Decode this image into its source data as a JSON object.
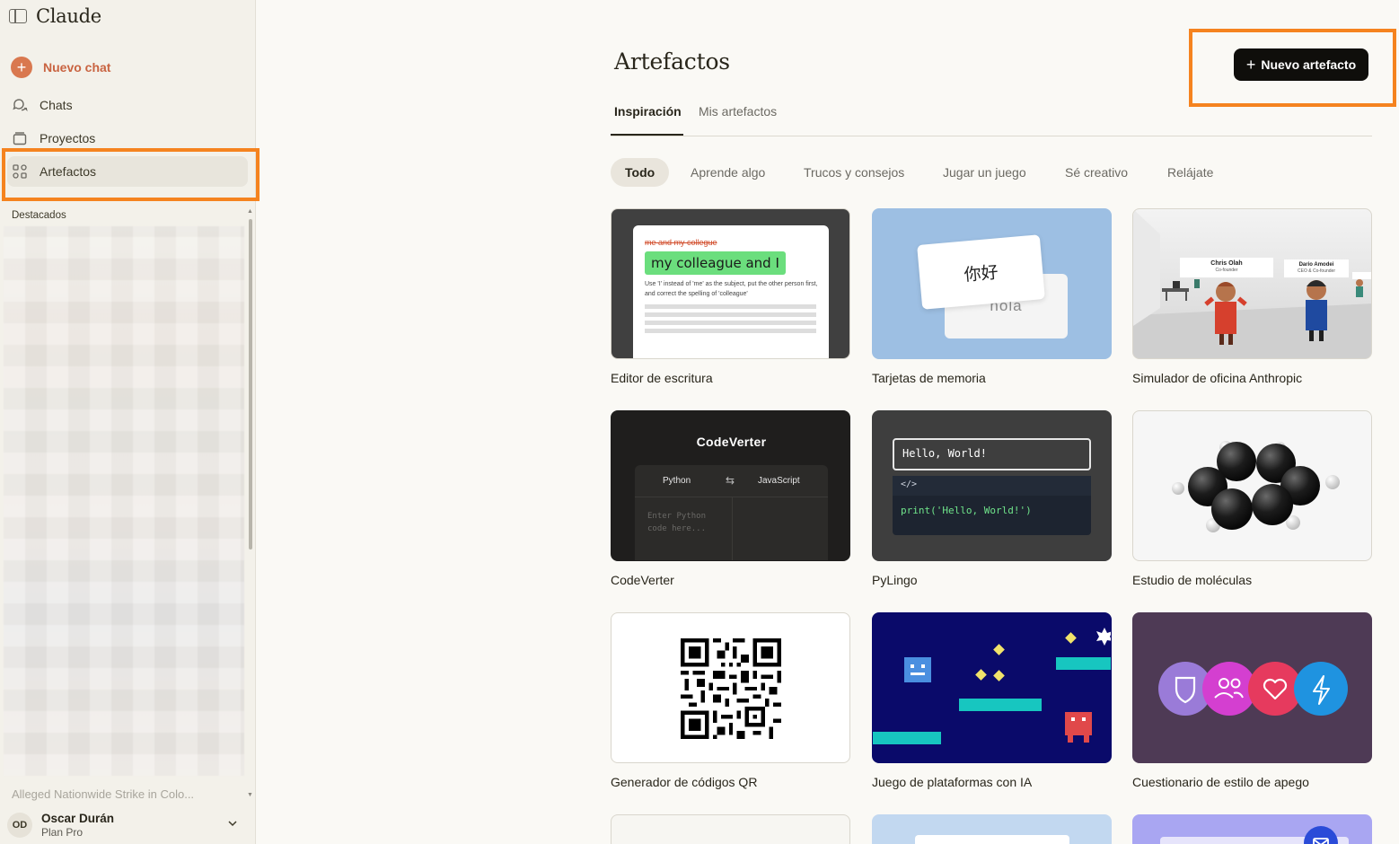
{
  "app": {
    "brand": "Claude"
  },
  "sidebar": {
    "new_chat": "Nuevo chat",
    "items": [
      {
        "label": "Chats",
        "icon": "chat-bubbles-icon"
      },
      {
        "label": "Proyectos",
        "icon": "folder-stack-icon"
      },
      {
        "label": "Artefactos",
        "icon": "artifacts-grid-icon"
      }
    ],
    "section_label": "Destacados",
    "recent_item": "Alleged Nationwide Strike in Colo...",
    "user": {
      "initials": "OD",
      "name": "Oscar Durán",
      "plan": "Plan Pro"
    }
  },
  "page": {
    "title": "Artefactos",
    "new_button": "Nuevo artefacto",
    "tabs": [
      "Inspiración",
      "Mis artefactos"
    ],
    "filters": [
      "Todo",
      "Aprende algo",
      "Trucos y consejos",
      "Jugar un juego",
      "Sé creativo",
      "Relájate"
    ]
  },
  "cards": [
    {
      "label": "Editor de escritura",
      "strike": "me and my collegue",
      "highlight": "my colleague and I",
      "note": "Use 'I' instead of 'me' as the subject, put the other person first, and correct the spelling of 'colleague'"
    },
    {
      "label": "Tarjetas de memoria",
      "front": "你好",
      "back": "hola"
    },
    {
      "label": "Simulador de oficina Anthropic",
      "sign1": "Chris Olah",
      "sign1_sub": "Co-founder",
      "sign2": "Dario Amodei",
      "sign2_sub": "CEO & Co-founder"
    },
    {
      "label": "CodeVerter",
      "heading": "CodeVerter",
      "from": "Python",
      "swap": "⇆",
      "to": "JavaScript",
      "placeholder": "Enter Python code here..."
    },
    {
      "label": "PyLingo",
      "output": "Hello, World!",
      "tag": "</>",
      "code": "print('Hello, World!')"
    },
    {
      "label": "Estudio de moléculas"
    },
    {
      "label": "Generador de códigos QR"
    },
    {
      "label": "Juego de plataformas con IA"
    },
    {
      "label": "Cuestionario de estilo de apego"
    }
  ],
  "colors": {
    "accent": "#c96442",
    "highlight_box": "#f5831f",
    "button_bg": "#0f0e0b"
  }
}
